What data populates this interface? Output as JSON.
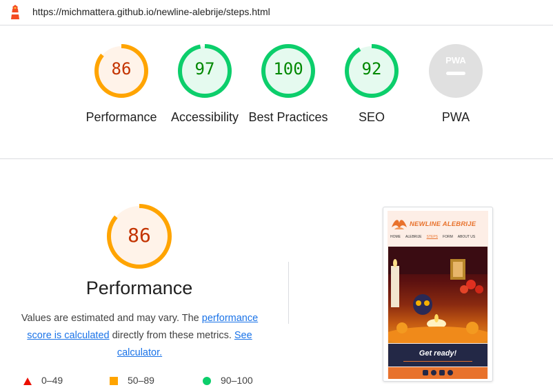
{
  "topbar": {
    "url": "https://michmattera.github.io/newline-alebrije/steps.html",
    "logo_icon": "lighthouse-icon"
  },
  "gauges": [
    {
      "label": "Performance",
      "score": "86",
      "value": 86,
      "status": "average"
    },
    {
      "label": "Accessibility",
      "score": "97",
      "value": 97,
      "status": "pass"
    },
    {
      "label": "Best Practices",
      "score": "100",
      "value": 100,
      "status": "pass"
    },
    {
      "label": "SEO",
      "score": "92",
      "value": 92,
      "status": "pass"
    },
    {
      "label": "PWA",
      "score": "",
      "value": 0,
      "status": "na",
      "badge": "PWA"
    }
  ],
  "performance": {
    "score": "86",
    "value": 86,
    "title": "Performance",
    "desc_part1": "Values are estimated and may vary. The ",
    "desc_link1": "performance score is calculated",
    "desc_part2": " directly from these metrics. ",
    "desc_link2": "See calculator."
  },
  "legend": [
    {
      "range": "0–49",
      "shape": "triangle-icon",
      "color": "#eb0f00"
    },
    {
      "range": "50–89",
      "shape": "square-icon",
      "color": "#ffa400"
    },
    {
      "range": "90–100",
      "shape": "circle-icon",
      "color": "#0cce6b"
    }
  ],
  "thumbnail": {
    "brand": "NEWLINE ALEBRIJE",
    "nav": [
      "HOME",
      "ALEBRIJE",
      "STEPS",
      "FORM",
      "ABOUT US"
    ],
    "active_nav": "STEPS",
    "cta": "Get ready!",
    "footer_icons": [
      "instagram-icon",
      "facebook-icon",
      "youtube-icon",
      "github-icon"
    ]
  },
  "colors": {
    "average": "#ffa400",
    "average_text": "#c33300",
    "average_bg": "#fff3e9",
    "pass": "#0cce6b",
    "pass_text": "#008800",
    "pass_bg": "#e5faef",
    "na": "#e0e0e0",
    "link": "#1a73e8",
    "brand_orange": "#e8722c",
    "cta_navy": "#232846"
  }
}
